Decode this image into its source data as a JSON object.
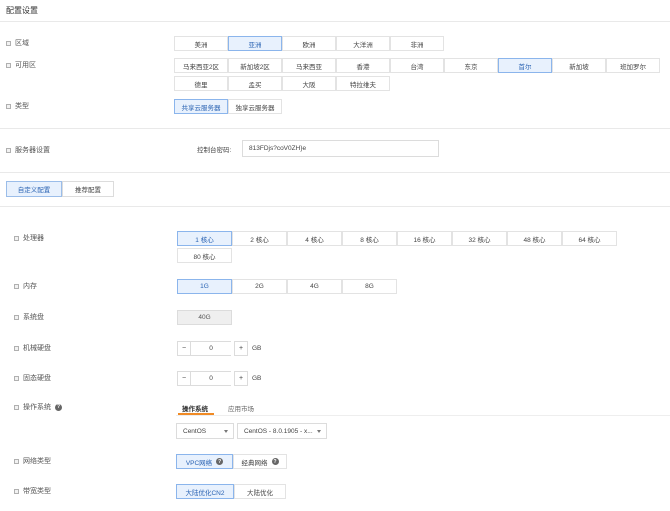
{
  "page_title": "配置设置",
  "region": {
    "label": "区域",
    "options": [
      "美洲",
      "亚洲",
      "欧洲",
      "大洋洲",
      "非洲"
    ],
    "selected": "亚洲"
  },
  "zone": {
    "label": "可用区",
    "options": [
      "马来西亚2区",
      "新加坡2区",
      "马来西亚",
      "香港",
      "台湾",
      "东京",
      "首尔",
      "新加坡",
      "班加罗尔",
      "德里",
      "孟买",
      "大阪",
      "特拉维夫"
    ],
    "selected": "首尔"
  },
  "type": {
    "label": "类型",
    "options": [
      "共享云服务器",
      "独享云服务器"
    ],
    "selected": "共享云服务器"
  },
  "server_settings": {
    "label": "服务器设置",
    "password_label": "控制台密码:",
    "password_value": "813FDjs?coV0ZH}e"
  },
  "config_tabs": {
    "options": [
      "自定义配置",
      "推荐配置"
    ],
    "selected": "自定义配置"
  },
  "cpu": {
    "label": "处理器",
    "options": [
      "1 核心",
      "2 核心",
      "4 核心",
      "8 核心",
      "16 核心",
      "32 核心",
      "48 核心",
      "64 核心",
      "80 核心"
    ],
    "selected": "1 核心"
  },
  "memory": {
    "label": "内存",
    "options": [
      "1G",
      "2G",
      "4G",
      "8G"
    ],
    "selected": "1G"
  },
  "system_disk": {
    "label": "系统盘",
    "value": "40G"
  },
  "hdd": {
    "label": "机械硬盘",
    "minus": "−",
    "value": "0",
    "plus": "+",
    "unit": "GB"
  },
  "ssd": {
    "label": "固态硬盘",
    "minus": "−",
    "value": "0",
    "plus": "+",
    "unit": "GB"
  },
  "os": {
    "label": "操作系统",
    "help": "?",
    "tabs": [
      "操作系统",
      "应用市场"
    ],
    "active_tab": "操作系统",
    "distro": "CentOS",
    "version": "CentOS - 8.0.1905 - x..."
  },
  "network": {
    "label": "网络类型",
    "options": [
      "VPC网络",
      "经典网络"
    ],
    "selected": "VPC网络",
    "help": "?"
  },
  "bandwidth": {
    "label": "带宽类型",
    "options": [
      "大陆优化CN2",
      "大陆优化"
    ],
    "selected": "大陆优化CN2"
  },
  "colors": {
    "selected_bg": "#e8f1fd",
    "selected_border": "#8bb5ec",
    "selected_text": "#2a63b3",
    "tab_underline": "#f08a24"
  }
}
